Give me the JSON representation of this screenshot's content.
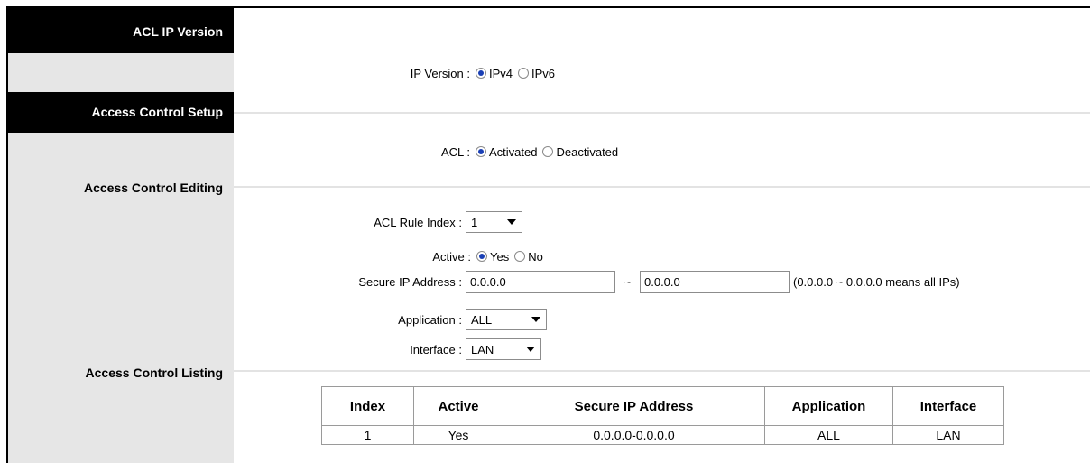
{
  "sections": {
    "ip_version": "ACL IP Version",
    "setup": "Access Control Setup",
    "editing": "Access Control Editing",
    "listing": "Access Control Listing"
  },
  "ip_version": {
    "label": "IP Version :",
    "options": [
      "IPv4",
      "IPv6"
    ],
    "selected": "IPv4"
  },
  "acl": {
    "label": "ACL :",
    "options": [
      "Activated",
      "Deactivated"
    ],
    "selected": "Activated"
  },
  "editing": {
    "rule_index_label": "ACL Rule Index :",
    "rule_index_value": "1",
    "active_label": "Active :",
    "active_options": [
      "Yes",
      "No"
    ],
    "active_selected": "Yes",
    "secure_ip_label": "Secure IP Address :",
    "secure_ip_start": "0.0.0.0",
    "secure_ip_separator": "~",
    "secure_ip_end": "0.0.0.0",
    "secure_ip_hint": "(0.0.0.0 ~ 0.0.0.0 means all IPs)",
    "application_label": "Application :",
    "application_value": "ALL",
    "interface_label": "Interface :",
    "interface_value": "LAN"
  },
  "listing": {
    "headers": [
      "Index",
      "Active",
      "Secure IP Address",
      "Application",
      "Interface"
    ],
    "rows": [
      [
        "1",
        "Yes",
        "0.0.0.0-0.0.0.0",
        "ALL",
        "LAN"
      ]
    ]
  },
  "colors": {
    "dark_header": "#000000",
    "sidebar": "#e6e6e6",
    "radio_selected": "#1a3fb5"
  }
}
